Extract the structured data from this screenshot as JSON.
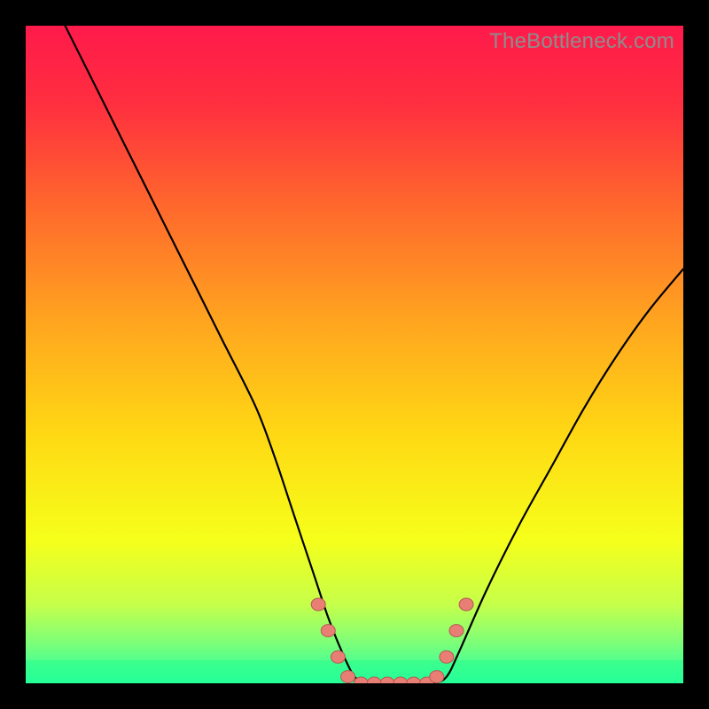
{
  "watermark": "TheBottleneck.com",
  "colors": {
    "frame": "#000000",
    "gradient_stops": [
      {
        "offset": 0.0,
        "color": "#ff1a4b"
      },
      {
        "offset": 0.12,
        "color": "#ff2f3f"
      },
      {
        "offset": 0.28,
        "color": "#ff6a2c"
      },
      {
        "offset": 0.45,
        "color": "#ffa51f"
      },
      {
        "offset": 0.62,
        "color": "#ffd814"
      },
      {
        "offset": 0.78,
        "color": "#f6ff1a"
      },
      {
        "offset": 0.88,
        "color": "#c6ff4a"
      },
      {
        "offset": 0.94,
        "color": "#7bff7a"
      },
      {
        "offset": 1.0,
        "color": "#1fffa6"
      }
    ],
    "green_band": "#2aff8d",
    "curve": "#000000",
    "marker_fill": "#e97e75",
    "marker_stroke": "#b45a53"
  },
  "chart_data": {
    "type": "line",
    "title": "",
    "xlabel": "",
    "ylabel": "",
    "xlim": [
      0,
      100
    ],
    "ylim": [
      0,
      100
    ],
    "note": "Axes unlabeled; values are pixel-fraction estimates (0–100) read off the plot area.",
    "series": [
      {
        "name": "bottleneck-curve",
        "x": [
          6,
          10,
          15,
          20,
          25,
          30,
          35,
          38,
          40,
          42,
          44,
          46,
          48,
          50,
          52,
          54,
          56,
          58,
          60,
          62,
          64,
          66,
          70,
          75,
          80,
          85,
          90,
          95,
          100
        ],
        "y": [
          100,
          92,
          82,
          72,
          62,
          52,
          42,
          34,
          28,
          22,
          16,
          10,
          5,
          1,
          0,
          0,
          0,
          0,
          0,
          0,
          1,
          5,
          14,
          24,
          33,
          42,
          50,
          57,
          63
        ]
      }
    ],
    "markers": {
      "name": "highlight-points",
      "x": [
        44.5,
        46,
        47.5,
        49,
        51,
        53,
        55,
        57,
        59,
        61,
        62.5,
        64,
        65.5,
        67
      ],
      "y": [
        12,
        8,
        4,
        1,
        0,
        0,
        0,
        0,
        0,
        0,
        1,
        4,
        8,
        12
      ]
    }
  }
}
